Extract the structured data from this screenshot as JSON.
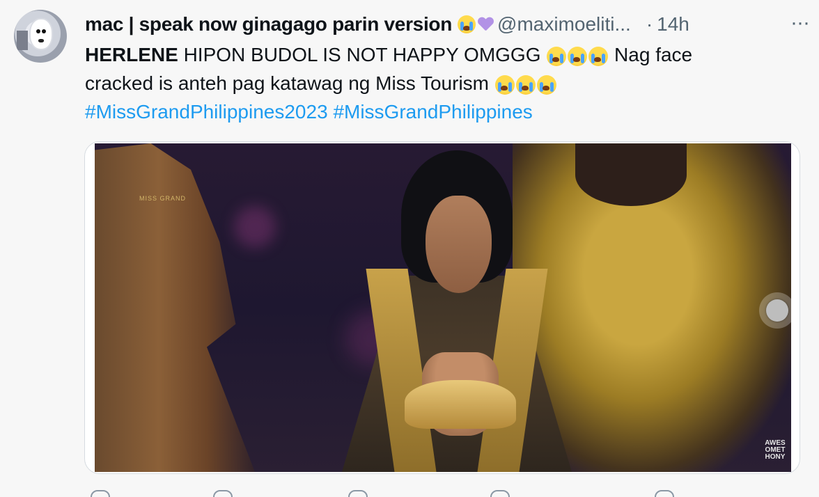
{
  "tweet": {
    "display_name": "mac | speak now ginagago parin version",
    "handle": "@maximoeliti...",
    "separator": "·",
    "time": "14h",
    "more": "···",
    "text": {
      "bold": "HERLENE",
      "line1": " HIPON BUDOL IS NOT HAPPY OMGGG ",
      "line1_after": " Nag face",
      "line2": "cracked is anteh pag katawag ng Miss Tourism ",
      "hashtag1": "#MissGrandPhilippines2023",
      "hashtag2": "#MissGrandPhilippines"
    },
    "emoji": {
      "crying": "loudly-crying-face",
      "heart": "purple-heart"
    }
  },
  "media": {
    "type": "video",
    "watermark_top": "MISS GRAND",
    "watermark_corner": "AWES OMET HONY"
  },
  "colors": {
    "link": "#1d9bf0",
    "secondary": "#536471",
    "background": "#f7f7f7"
  }
}
